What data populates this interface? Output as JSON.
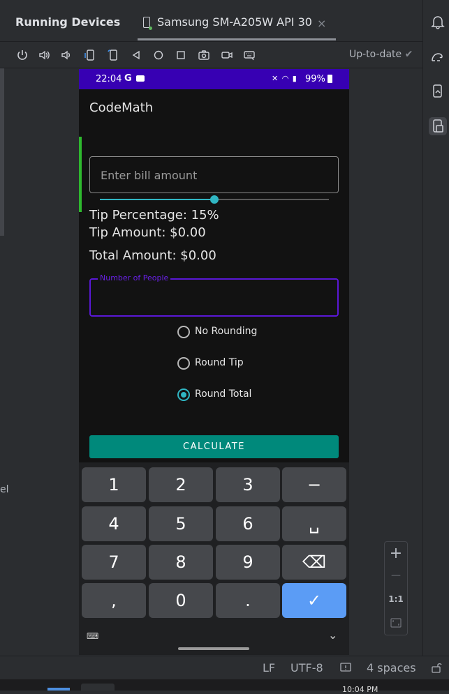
{
  "window": {
    "tool_title": "Running Devices",
    "device_tab": "Samsung SM-A205W API 30",
    "tab_close": "×",
    "sync_status": "Up-to-date",
    "sync_check": "✔"
  },
  "toolbar": {
    "buttons": [
      "power-icon",
      "volume-up-icon",
      "volume-down-icon",
      "rotate-left-icon",
      "rotate-right-icon",
      "back-icon",
      "home-icon",
      "overview-icon",
      "screenshot-icon",
      "screen-record-icon",
      "keyboard-icon"
    ]
  },
  "left_cut_text": "el",
  "phone": {
    "status": {
      "time": "22:04",
      "carrier_glyph": "G",
      "icons": "✕ ◠ ▮",
      "battery": "99%"
    },
    "app_title": "CodeMath",
    "bill_placeholder": "Enter bill amount",
    "slider_value_fraction": 0.5,
    "tip_percentage": "Tip Percentage: 15%",
    "tip_amount": "Tip Amount: $0.00",
    "total_amount": "Total Amount: $0.00",
    "people_label": "Number of People",
    "rounding": [
      {
        "label": "No Rounding",
        "checked": false
      },
      {
        "label": "Round Tip",
        "checked": false
      },
      {
        "label": "Round Total",
        "checked": true
      }
    ],
    "calculate_label": "CALCULATE",
    "keys": [
      "1",
      "2",
      "3",
      "−",
      "4",
      "5",
      "6",
      "␣",
      "7",
      "8",
      "9",
      "⌫",
      ",",
      "0",
      ".",
      "✓"
    ],
    "kb_icon": "⌨",
    "kb_collapse": "⌄"
  },
  "zoom": {
    "plus": "+",
    "minus": "—",
    "one_to_one": "1:1"
  },
  "statusline": {
    "lf": "LF",
    "encoding": "UTF-8",
    "indent": "4 spaces"
  },
  "taskbar": {
    "clock": "10:04 PM"
  },
  "colors": {
    "status_purple": "#3700b3",
    "accent_teal": "#30b6c3",
    "button_green": "#00897b",
    "field_purple": "#5a18d6",
    "done_blue": "#5b9cf5"
  }
}
